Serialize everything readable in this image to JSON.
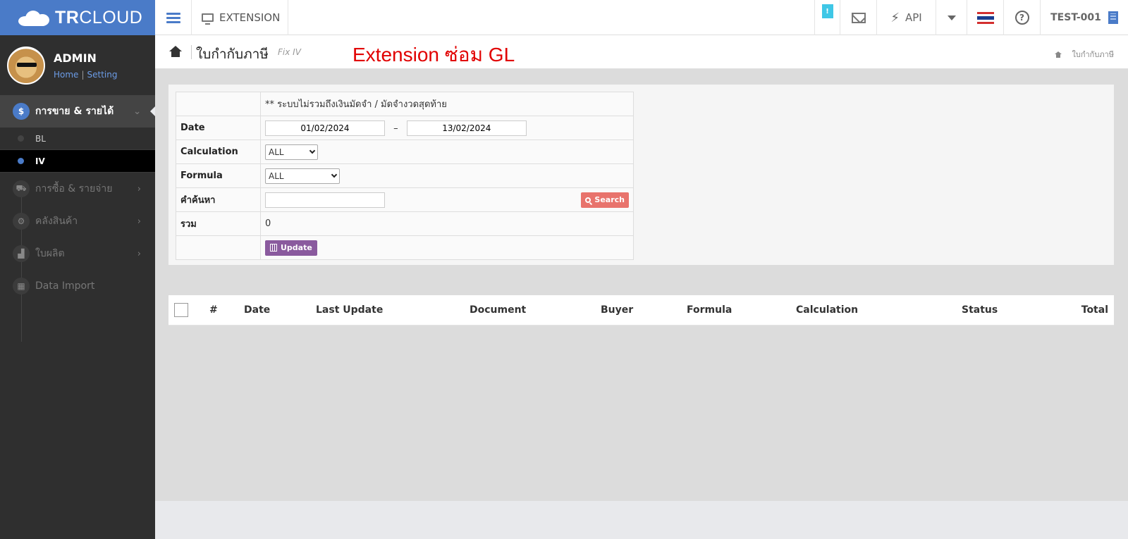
{
  "header": {
    "brand_bold": "TR",
    "brand_rest": "CLOUD",
    "extension_tab": "EXTENSION",
    "notification_badge": "!",
    "api_label": "API",
    "company": "TEST-001"
  },
  "sidebar": {
    "user_name": "ADMIN",
    "home_link": "Home",
    "setting_link": "Setting",
    "items": [
      {
        "label": "การขาย & รายได้",
        "icon": "dollar-icon"
      },
      {
        "label": "การซื้อ & รายจ่าย",
        "icon": "cart-icon"
      },
      {
        "label": "คลังสินค้า",
        "icon": "cubes-icon"
      },
      {
        "label": "ใบผลิต",
        "icon": "factory-icon"
      },
      {
        "label": "Data Import",
        "icon": "table-icon"
      }
    ],
    "sub_items": [
      "BL",
      "IV"
    ]
  },
  "page_header": {
    "title": "ใบกำกับภาษี",
    "subtitle": "Fix IV",
    "extension_note": "Extension ซ่อม GL",
    "breadcrumb": "ใบกำกับภาษี"
  },
  "form": {
    "note": "** ระบบไม่รวมถึงเงินมัดจำ / มัดจำงวดสุดท้าย",
    "date_label": "Date",
    "date_from": "01/02/2024",
    "date_separator": "–",
    "date_to": "13/02/2024",
    "calculation_label": "Calculation",
    "calculation_value": "ALL",
    "formula_label": "Formula",
    "formula_value": "ALL",
    "search_label": "คำค้นหา",
    "search_button": "Search",
    "total_label": "รวม",
    "total_value": "0",
    "update_button": "Update"
  },
  "table": {
    "columns": [
      "#",
      "Date",
      "Last Update",
      "Document",
      "Buyer",
      "Formula",
      "Calculation",
      "Status",
      "Total"
    ]
  },
  "colors": {
    "brand_blue": "#4a7bc8",
    "search_red": "#e8736c",
    "update_purple": "#8a5a9e",
    "extension_red": "#e10000"
  }
}
